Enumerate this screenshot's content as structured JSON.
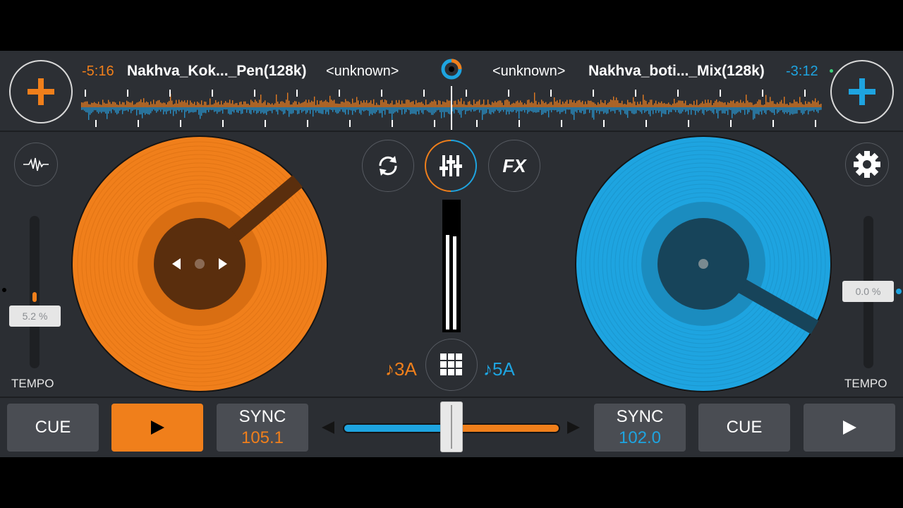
{
  "deck_left": {
    "remaining_time": "-5:16",
    "title": "Nakhva_Kok..._Pen(128k)",
    "artist": "<unknown>",
    "tempo_value": "5.2 %",
    "tempo_label": "TEMPO",
    "key": "♪3A",
    "cue_label": "CUE",
    "sync_label": "SYNC",
    "bpm": "105.1",
    "play_icon": "play-icon",
    "color": "#f07f1b",
    "tempo_fader_level": 0.05
  },
  "deck_right": {
    "remaining_time": "-3:12",
    "title": "Nakhva_boti..._Mix(128k)",
    "artist": "<unknown>",
    "tempo_value": "0.0 %",
    "tempo_label": "TEMPO",
    "key": "♪5A",
    "cue_label": "CUE",
    "sync_label": "SYNC",
    "bpm": "102.0",
    "play_icon": "play-icon",
    "color": "#1ea4e0",
    "tempo_fader_level": 0.0
  },
  "center": {
    "fx_label": "FX",
    "crossfader_position": 0.5
  },
  "icons": {
    "add_left": "plus-icon",
    "add_right": "plus-icon",
    "waveform": "waveform-icon",
    "settings": "gear-icon",
    "loop": "sync-loop-icon",
    "mixer": "mixer-sliders-icon",
    "sampler": "grid-icon"
  }
}
